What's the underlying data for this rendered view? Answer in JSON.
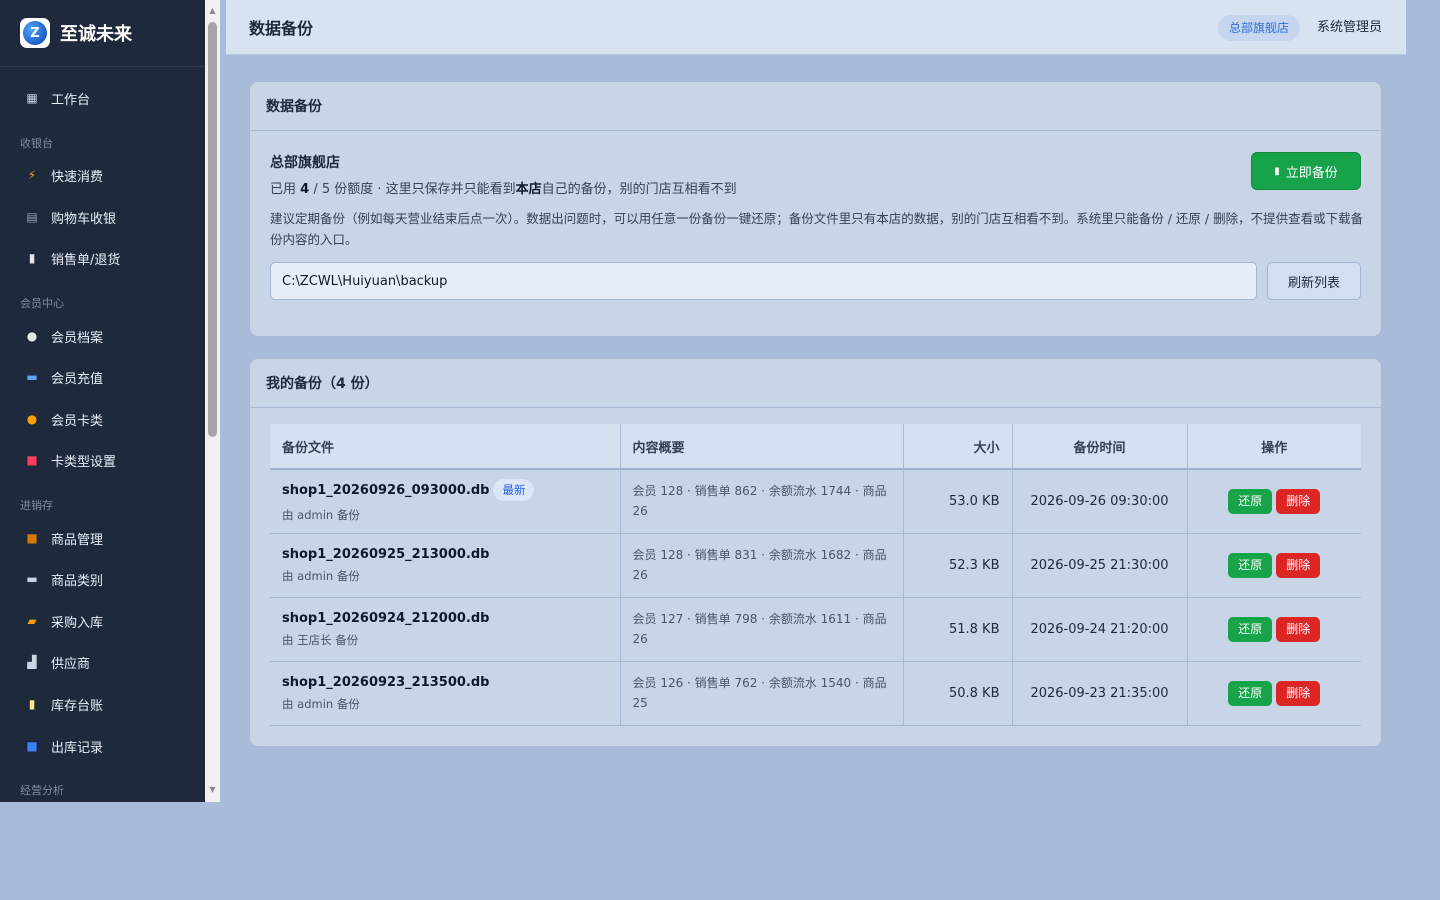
{
  "brand": {
    "logo_letter": "Z",
    "name": "至诚未来"
  },
  "sidebar": {
    "items": [
      {
        "label": "工作台",
        "icon": "grid-icon",
        "glyph": "▦",
        "color": "#c8d2e0"
      },
      {
        "label": "快速消费",
        "icon": "bolt-icon",
        "glyph": "⚡",
        "color": "#f59e0b"
      },
      {
        "label": "购物车收银",
        "icon": "cash-register-icon",
        "glyph": "▤",
        "color": "#94a3b8"
      },
      {
        "label": "销售单/退货",
        "icon": "receipt-icon",
        "glyph": "▮",
        "color": "#e5e7eb"
      },
      {
        "label": "会员档案",
        "icon": "user-icon",
        "glyph": "●",
        "color": "#e5e7eb"
      },
      {
        "label": "会员充值",
        "icon": "card-icon",
        "glyph": "▬",
        "color": "#60a5fa"
      },
      {
        "label": "会员卡类",
        "icon": "medal-icon",
        "glyph": "●",
        "color": "#f59e0b"
      },
      {
        "label": "卡类型设置",
        "icon": "card-settings-icon",
        "glyph": "■",
        "color": "#f43f5e"
      },
      {
        "label": "商品管理",
        "icon": "box-icon",
        "glyph": "■",
        "color": "#d97706"
      },
      {
        "label": "商品类别",
        "icon": "tag-icon",
        "glyph": "▬",
        "color": "#cbd5e1"
      },
      {
        "label": "采购入库",
        "icon": "truck-icon",
        "glyph": "▰",
        "color": "#f59e0b"
      },
      {
        "label": "供应商",
        "icon": "factory-icon",
        "glyph": "▟",
        "color": "#cbd5e1"
      },
      {
        "label": "库存台账",
        "icon": "clipboard-icon",
        "glyph": "▮",
        "color": "#fde68a"
      },
      {
        "label": "出库记录",
        "icon": "outbox-icon",
        "glyph": "■",
        "color": "#3b82f6"
      }
    ],
    "groups": [
      "收银台",
      "会员中心",
      "进销存",
      "经营分析"
    ]
  },
  "header": {
    "title": "数据备份",
    "store_badge": "总部旗舰店",
    "user": "系统管理员"
  },
  "backup_card": {
    "title": "数据备份",
    "store_name": "总部旗舰店",
    "quota_prefix": "已用 ",
    "quota_used": "4",
    "quota_mid": " / 5 份额度 · 这里只保存并只能看到",
    "quota_bold": "本店",
    "quota_suffix": "自己的备份，别的门店互相看不到",
    "note": "建议定期备份（例如每天营业结束后点一次）。数据出问题时，可以用任意一份备份一键还原；备份文件里只有本店的数据，别的门店互相看不到。系统里只能备份 / 还原 / 删除，不提供查看或下载备份内容的入口。",
    "backup_now_label": "立即备份",
    "path_value": "C:\\ZCWL\\Huiyuan\\backup",
    "refresh_label": "刷新列表"
  },
  "list_card": {
    "title": "我的备份（4 份）",
    "columns": [
      "备份文件",
      "内容概要",
      "大小",
      "备份时间",
      "操作"
    ],
    "latest_tag": "最新",
    "restore_label": "还原",
    "delete_label": "删除",
    "rows": [
      {
        "file": "shop1_20260926_093000.db",
        "by": "由 admin 备份",
        "summary": "会员 128 · 销售单 862 · 余额流水 1744 · 商品 26",
        "size": "53.0 KB",
        "time": "2026-09-26 09:30:00",
        "latest": true
      },
      {
        "file": "shop1_20260925_213000.db",
        "by": "由 admin 备份",
        "summary": "会员 128 · 销售单 831 · 余额流水 1682 · 商品 26",
        "size": "52.3 KB",
        "time": "2026-09-25 21:30:00",
        "latest": false
      },
      {
        "file": "shop1_20260924_212000.db",
        "by": "由 王店长 备份",
        "summary": "会员 127 · 销售单 798 · 余额流水 1611 · 商品 26",
        "size": "51.8 KB",
        "time": "2026-09-24 21:20:00",
        "latest": false
      },
      {
        "file": "shop1_20260923_213500.db",
        "by": "由 admin 备份",
        "summary": "会员 126 · 销售单 762 · 余额流水 1540 · 商品 25",
        "size": "50.8 KB",
        "time": "2026-09-23 21:35:00",
        "latest": false
      }
    ]
  }
}
